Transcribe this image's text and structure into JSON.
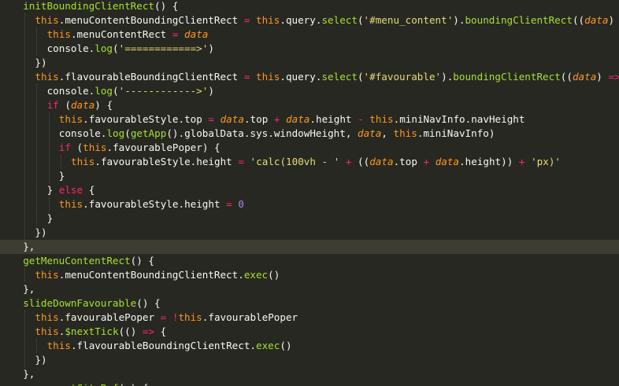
{
  "editor": {
    "theme": "monokai",
    "colors": {
      "background": "#272822",
      "current_line": "#3e3d32",
      "function": "#a6e22e",
      "this": "#fd971f",
      "keyword": "#f92672",
      "string": "#e6db74",
      "number": "#ae81ff",
      "text": "#f8f8f2"
    },
    "current_line_index": 17,
    "lines": [
      {
        "indent": 2,
        "tokens": [
          [
            "fn",
            "initBoundingClientRect"
          ],
          [
            "punct",
            "() {"
          ]
        ]
      },
      {
        "indent": 4,
        "tokens": [
          [
            "this",
            "this"
          ],
          [
            "punct",
            "."
          ],
          [
            "ident",
            "menuContentBoundingClientRect"
          ],
          [
            "punct",
            " "
          ],
          [
            "op",
            "="
          ],
          [
            "punct",
            " "
          ],
          [
            "this",
            "this"
          ],
          [
            "punct",
            "."
          ],
          [
            "ident",
            "query"
          ],
          [
            "punct",
            "."
          ],
          [
            "fn",
            "select"
          ],
          [
            "punct",
            "("
          ],
          [
            "str",
            "'#menu_content'"
          ],
          [
            "punct",
            ")."
          ],
          [
            "fn",
            "boundingClientRect"
          ],
          [
            "punct",
            "(("
          ],
          [
            "param",
            "data"
          ],
          [
            "punct",
            ") "
          ],
          [
            "kw",
            "=>"
          ],
          [
            "punct",
            " {"
          ]
        ]
      },
      {
        "indent": 6,
        "tokens": [
          [
            "this",
            "this"
          ],
          [
            "punct",
            "."
          ],
          [
            "ident",
            "menuContentRect"
          ],
          [
            "punct",
            " "
          ],
          [
            "op",
            "="
          ],
          [
            "punct",
            " "
          ],
          [
            "param",
            "data"
          ]
        ]
      },
      {
        "indent": 6,
        "tokens": [
          [
            "ident",
            "console"
          ],
          [
            "punct",
            "."
          ],
          [
            "fn",
            "log"
          ],
          [
            "punct",
            "("
          ],
          [
            "str",
            "'============>'"
          ],
          [
            "punct",
            ")"
          ]
        ]
      },
      {
        "indent": 4,
        "tokens": [
          [
            "punct",
            "})"
          ]
        ]
      },
      {
        "indent": 4,
        "tokens": [
          [
            "this",
            "this"
          ],
          [
            "punct",
            "."
          ],
          [
            "ident",
            "flavourableBoundingClientRect"
          ],
          [
            "punct",
            " "
          ],
          [
            "op",
            "="
          ],
          [
            "punct",
            " "
          ],
          [
            "this",
            "this"
          ],
          [
            "punct",
            "."
          ],
          [
            "ident",
            "query"
          ],
          [
            "punct",
            "."
          ],
          [
            "fn",
            "select"
          ],
          [
            "punct",
            "("
          ],
          [
            "str",
            "'#favourable'"
          ],
          [
            "punct",
            ")."
          ],
          [
            "fn",
            "boundingClientRect"
          ],
          [
            "punct",
            "(("
          ],
          [
            "param",
            "data"
          ],
          [
            "punct",
            ") "
          ],
          [
            "kw",
            "=>"
          ],
          [
            "punct",
            " {"
          ]
        ]
      },
      {
        "indent": 6,
        "tokens": [
          [
            "ident",
            "console"
          ],
          [
            "punct",
            "."
          ],
          [
            "fn",
            "log"
          ],
          [
            "punct",
            "("
          ],
          [
            "str",
            "'------------>'"
          ],
          [
            "punct",
            ")"
          ]
        ]
      },
      {
        "indent": 6,
        "tokens": [
          [
            "kw",
            "if"
          ],
          [
            "punct",
            " ("
          ],
          [
            "param",
            "data"
          ],
          [
            "punct",
            ") {"
          ]
        ]
      },
      {
        "indent": 8,
        "tokens": [
          [
            "this",
            "this"
          ],
          [
            "punct",
            "."
          ],
          [
            "ident",
            "favourableStyle"
          ],
          [
            "punct",
            "."
          ],
          [
            "ident",
            "top"
          ],
          [
            "punct",
            " "
          ],
          [
            "op",
            "="
          ],
          [
            "punct",
            " "
          ],
          [
            "param",
            "data"
          ],
          [
            "punct",
            "."
          ],
          [
            "ident",
            "top"
          ],
          [
            "punct",
            " "
          ],
          [
            "op",
            "+"
          ],
          [
            "punct",
            " "
          ],
          [
            "param",
            "data"
          ],
          [
            "punct",
            "."
          ],
          [
            "ident",
            "height"
          ],
          [
            "punct",
            " "
          ],
          [
            "op",
            "-"
          ],
          [
            "punct",
            " "
          ],
          [
            "this",
            "this"
          ],
          [
            "punct",
            "."
          ],
          [
            "ident",
            "miniNavInfo"
          ],
          [
            "punct",
            "."
          ],
          [
            "ident",
            "navHeight"
          ]
        ]
      },
      {
        "indent": 8,
        "tokens": [
          [
            "ident",
            "console"
          ],
          [
            "punct",
            "."
          ],
          [
            "fn",
            "log"
          ],
          [
            "punct",
            "("
          ],
          [
            "fn",
            "getApp"
          ],
          [
            "punct",
            "()."
          ],
          [
            "ident",
            "globalData"
          ],
          [
            "punct",
            "."
          ],
          [
            "ident",
            "sys"
          ],
          [
            "punct",
            "."
          ],
          [
            "ident",
            "windowHeight"
          ],
          [
            "punct",
            ", "
          ],
          [
            "param",
            "data"
          ],
          [
            "punct",
            ", "
          ],
          [
            "this",
            "this"
          ],
          [
            "punct",
            "."
          ],
          [
            "ident",
            "miniNavInfo"
          ],
          [
            "punct",
            ")"
          ]
        ]
      },
      {
        "indent": 8,
        "tokens": [
          [
            "kw",
            "if"
          ],
          [
            "punct",
            " ("
          ],
          [
            "this",
            "this"
          ],
          [
            "punct",
            "."
          ],
          [
            "ident",
            "favourablePoper"
          ],
          [
            "punct",
            ") {"
          ]
        ]
      },
      {
        "indent": 10,
        "tokens": [
          [
            "this",
            "this"
          ],
          [
            "punct",
            "."
          ],
          [
            "ident",
            "favourableStyle"
          ],
          [
            "punct",
            "."
          ],
          [
            "ident",
            "height"
          ],
          [
            "punct",
            " "
          ],
          [
            "op",
            "="
          ],
          [
            "punct",
            " "
          ],
          [
            "str",
            "'calc(100vh - '"
          ],
          [
            "punct",
            " "
          ],
          [
            "op",
            "+"
          ],
          [
            "punct",
            " (("
          ],
          [
            "param",
            "data"
          ],
          [
            "punct",
            "."
          ],
          [
            "ident",
            "top"
          ],
          [
            "punct",
            " "
          ],
          [
            "op",
            "+"
          ],
          [
            "punct",
            " "
          ],
          [
            "param",
            "data"
          ],
          [
            "punct",
            "."
          ],
          [
            "ident",
            "height"
          ],
          [
            "punct",
            "))"
          ],
          [
            "punct",
            " "
          ],
          [
            "op",
            "+"
          ],
          [
            "punct",
            " "
          ],
          [
            "str",
            "'px)'"
          ]
        ]
      },
      {
        "indent": 8,
        "tokens": [
          [
            "punct",
            "}"
          ]
        ]
      },
      {
        "indent": 6,
        "tokens": [
          [
            "punct",
            "} "
          ],
          [
            "kw",
            "else"
          ],
          [
            "punct",
            " {"
          ]
        ]
      },
      {
        "indent": 8,
        "tokens": [
          [
            "this",
            "this"
          ],
          [
            "punct",
            "."
          ],
          [
            "ident",
            "favourableStyle"
          ],
          [
            "punct",
            "."
          ],
          [
            "ident",
            "height"
          ],
          [
            "punct",
            " "
          ],
          [
            "op",
            "="
          ],
          [
            "punct",
            " "
          ],
          [
            "num",
            "0"
          ]
        ]
      },
      {
        "indent": 6,
        "tokens": [
          [
            "punct",
            "}"
          ]
        ]
      },
      {
        "indent": 4,
        "tokens": [
          [
            "punct",
            "})"
          ]
        ]
      },
      {
        "indent": 2,
        "tokens": [
          [
            "punct",
            "},"
          ]
        ]
      },
      {
        "indent": 2,
        "tokens": [
          [
            "fn",
            "getMenuContentRect"
          ],
          [
            "punct",
            "() {"
          ]
        ]
      },
      {
        "indent": 4,
        "tokens": [
          [
            "this",
            "this"
          ],
          [
            "punct",
            "."
          ],
          [
            "ident",
            "menuContentBoundingClientRect"
          ],
          [
            "punct",
            "."
          ],
          [
            "fn",
            "exec"
          ],
          [
            "punct",
            "()"
          ]
        ]
      },
      {
        "indent": 2,
        "tokens": [
          [
            "punct",
            "},"
          ]
        ]
      },
      {
        "indent": 2,
        "tokens": [
          [
            "fn",
            "slideDownFavourable"
          ],
          [
            "punct",
            "() {"
          ]
        ]
      },
      {
        "indent": 4,
        "tokens": [
          [
            "this",
            "this"
          ],
          [
            "punct",
            "."
          ],
          [
            "ident",
            "favourablePoper"
          ],
          [
            "punct",
            " "
          ],
          [
            "op",
            "="
          ],
          [
            "punct",
            " "
          ],
          [
            "op",
            "!"
          ],
          [
            "this",
            "this"
          ],
          [
            "punct",
            "."
          ],
          [
            "ident",
            "favourablePoper"
          ]
        ]
      },
      {
        "indent": 4,
        "tokens": [
          [
            "this",
            "this"
          ],
          [
            "punct",
            "."
          ],
          [
            "fn",
            "$nextTick"
          ],
          [
            "punct",
            "(() "
          ],
          [
            "kw",
            "=>"
          ],
          [
            "punct",
            " {"
          ]
        ]
      },
      {
        "indent": 6,
        "tokens": [
          [
            "this",
            "this"
          ],
          [
            "punct",
            "."
          ],
          [
            "ident",
            "flavourableBoundingClientRect"
          ],
          [
            "punct",
            "."
          ],
          [
            "fn",
            "exec"
          ],
          [
            "punct",
            "()"
          ]
        ]
      },
      {
        "indent": 4,
        "tokens": [
          [
            "punct",
            "})"
          ]
        ]
      },
      {
        "indent": 2,
        "tokens": [
          [
            "punct",
            "},"
          ]
        ]
      },
      {
        "indent": 2,
        "tokens": [
          [
            "punct",
            "      "
          ],
          [
            "fn",
            "setCityRef"
          ],
          [
            "punct",
            "(e) {"
          ]
        ]
      }
    ]
  }
}
